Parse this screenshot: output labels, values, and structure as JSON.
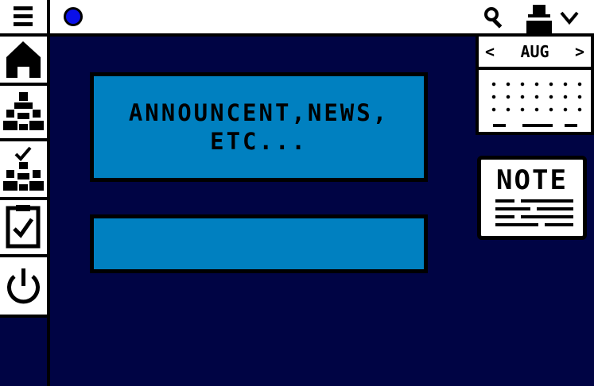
{
  "topbar": {
    "status_color": "#0a10e8",
    "icons": [
      "search-icon",
      "user-icon",
      "chevron-down-icon"
    ]
  },
  "sidebar": {
    "items": [
      {
        "name": "menu",
        "icon": "hamburger-menu-icon"
      },
      {
        "name": "home",
        "icon": "home-icon"
      },
      {
        "name": "people",
        "icon": "people-icon"
      },
      {
        "name": "people-check",
        "icon": "people-check-icon"
      },
      {
        "name": "tasks",
        "icon": "clipboard-check-icon"
      },
      {
        "name": "power",
        "icon": "power-icon"
      }
    ]
  },
  "main": {
    "announcement_text": "ANNOUNCENT,NEWS, ETC...",
    "secondary_panel_text": ""
  },
  "calendar": {
    "prev": "<",
    "month": "AUG",
    "next": ">"
  },
  "note": {
    "title": "NOTE"
  },
  "colors": {
    "background": "#000444",
    "panel": "#0080c0",
    "frame": "#000000"
  }
}
